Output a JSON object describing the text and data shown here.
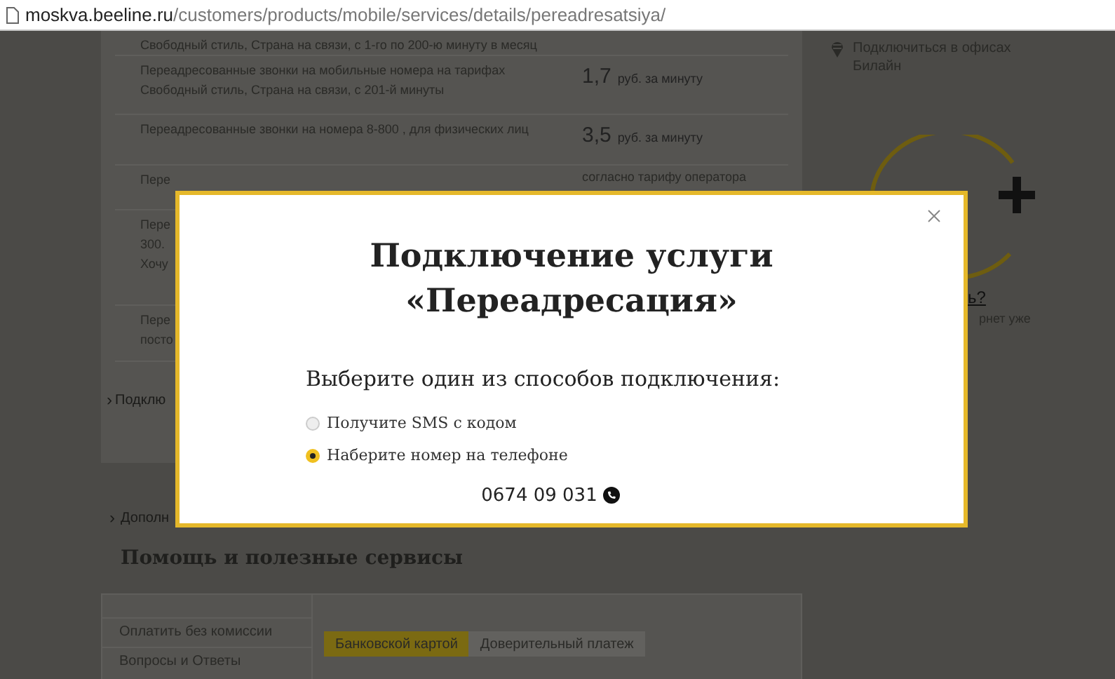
{
  "address_bar": {
    "host": "moskva.beeline.ru",
    "path": "/customers/products/mobile/services/details/pereadresatsiya/"
  },
  "tariff_table": {
    "rows": [
      {
        "lines": [
          "Свободный стиль, Страна на связи, с 1-го по 200-ю минуту в месяц"
        ]
      },
      {
        "lines": [
          "Переадресованные звонки на мобильные номера на тарифах",
          "Свободный стиль, Страна на связи, с 201-й минуты"
        ],
        "price": "1,7",
        "unit": "руб. за минуту"
      },
      {
        "lines": [
          "Переадресованные звонки на номера 8-800 , для физических лиц"
        ],
        "price": "3,5",
        "unit": "руб. за минуту"
      },
      {
        "lines": [
          "Пере"
        ],
        "note": "согласно тарифу оператора"
      },
      {
        "lines": [
          "Пере",
          "300.",
          "Хочу"
        ]
      },
      {
        "lines": [
          "Пере",
          "посто"
        ]
      }
    ]
  },
  "connect_link": {
    "chevron": "›",
    "label": "Подклю"
  },
  "additional_link": {
    "chevron": "›",
    "label": "Дополн"
  },
  "help_section": {
    "title": "Помощь и полезные сервисы",
    "menu": [
      {
        "label": "Оплатить без комиссии"
      },
      {
        "label": "Вопросы и Ответы"
      }
    ],
    "tabs": [
      {
        "label": "Банковской картой",
        "selected": true
      },
      {
        "label": "Доверительный платеж",
        "selected": false
      }
    ]
  },
  "sidebar": {
    "office_text": "Подключиться в офисах",
    "office_link": "Билайн",
    "question_link": "ь?",
    "note": "рнет уже"
  },
  "modal": {
    "title_lines": [
      "Подключение услуги",
      "«Переадресация»"
    ],
    "prompt": "Выберите один из способов подключения:",
    "options": [
      {
        "label": "Получите SMS с кодом",
        "selected": false
      },
      {
        "label": "Наберите номер на телефоне",
        "selected": true
      }
    ],
    "phone": "0674 09 031"
  }
}
